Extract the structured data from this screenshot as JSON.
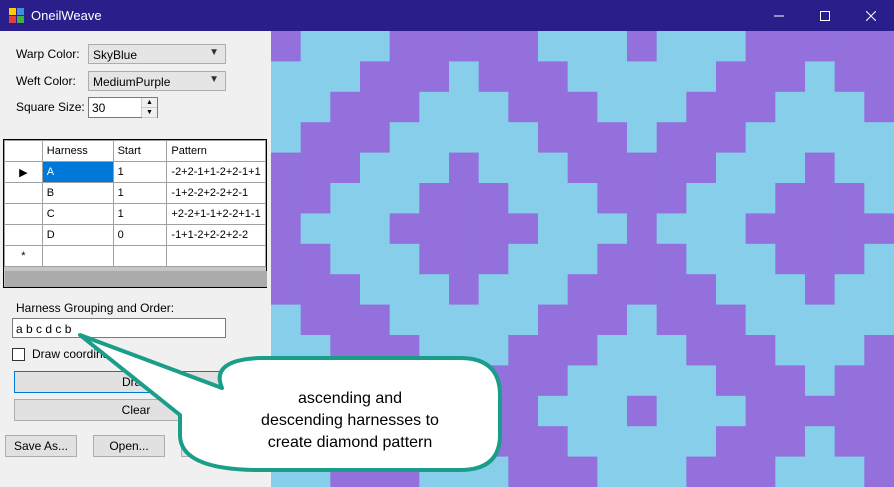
{
  "window": {
    "title": "OneilWeave",
    "controls": [
      "minimize-icon",
      "maximize-icon",
      "close-icon"
    ]
  },
  "form": {
    "warp_label": "Warp Color:",
    "warp_value": "SkyBlue",
    "weft_label": "Weft Color:",
    "weft_value": "MediumPurple",
    "square_label": "Square Size:",
    "square_value": "30"
  },
  "table": {
    "headers": [
      "Harness",
      "Start",
      "Pattern"
    ],
    "rows": [
      {
        "harness": "A",
        "start": "1",
        "pattern": "-2+2-1+1-2+2-1+1"
      },
      {
        "harness": "B",
        "start": "1",
        "pattern": "-1+2-2+2-2+2-1"
      },
      {
        "harness": "C",
        "start": "1",
        "pattern": "+2-2+1-1+2-2+1-1"
      },
      {
        "harness": "D",
        "start": "0",
        "pattern": "-1+1-2+2-2+2-2"
      }
    ],
    "new_row_marker": "*"
  },
  "grouping": {
    "label": "Harness Grouping and Order:",
    "value": "a b c d c b"
  },
  "checkbox": {
    "label": "Draw coordinates"
  },
  "buttons": {
    "draw": "Draw",
    "clear": "Clear",
    "save_as": "Save As...",
    "open": "Open..."
  },
  "callout": {
    "line1": "ascending and",
    "line2": "descending harnesses to",
    "line3": "create diamond pattern"
  },
  "colors": {
    "warp": "#87ceeb",
    "weft": "#9370db",
    "titlebar": "#2a1f8a",
    "callout_border": "#1a9e8a"
  }
}
